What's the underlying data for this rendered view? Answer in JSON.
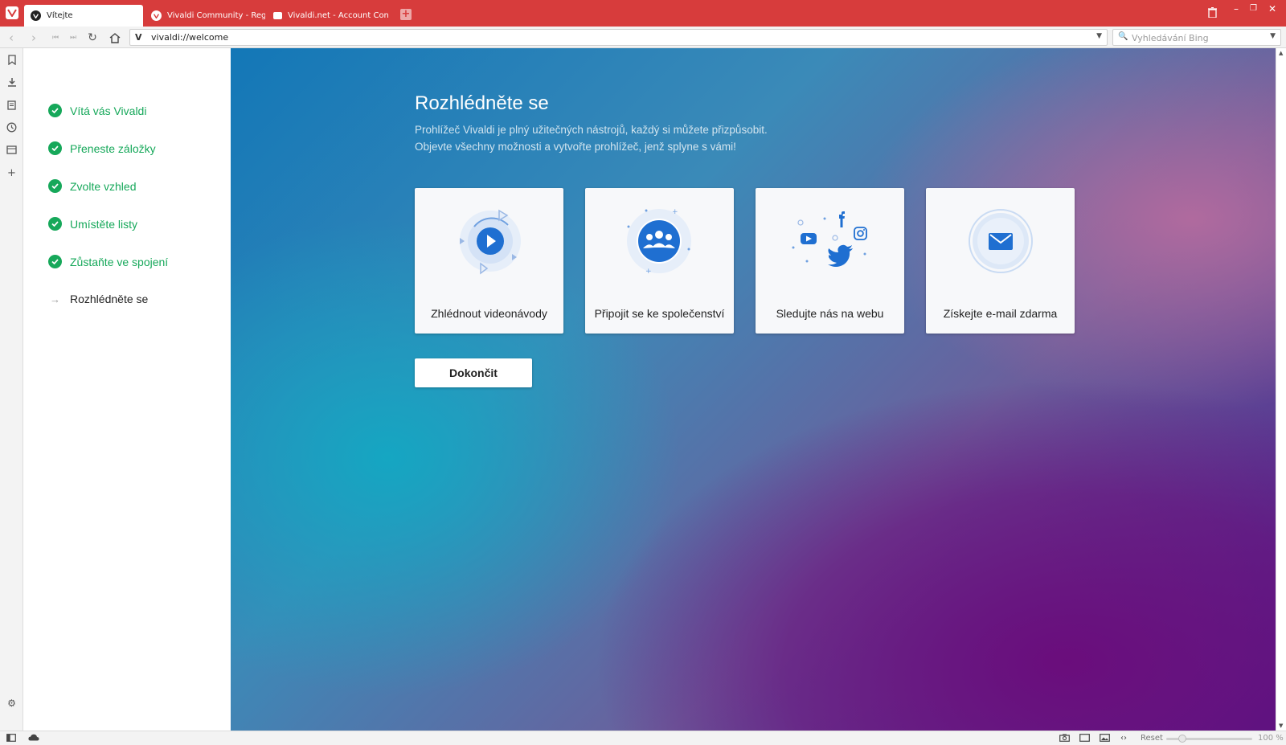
{
  "tabs": [
    {
      "label": "Vítejte",
      "active": true
    },
    {
      "label": "Vivaldi Community - Regist",
      "active": false
    },
    {
      "label": "Vivaldi.net - Account Confir",
      "active": false
    }
  ],
  "address": {
    "url": "vivaldi://welcome",
    "search_placeholder": "Vyhledávání Bing"
  },
  "steps": [
    {
      "label": "Vítá vás Vivaldi",
      "done": true
    },
    {
      "label": "Přeneste záložky",
      "done": true
    },
    {
      "label": "Zvolte vzhled",
      "done": true
    },
    {
      "label": "Umístěte listy",
      "done": true
    },
    {
      "label": "Zůstaňte ve spojení",
      "done": true
    },
    {
      "label": "Rozhlédněte se",
      "done": false
    }
  ],
  "main": {
    "title": "Rozhlédněte se",
    "subtitle_line1": "Prohlížeč Vivaldi je plný užitečných nástrojů, každý si můžete přizpůsobit.",
    "subtitle_line2": "Objevte všechny možnosti a vytvořte prohlížeč, jenž splyne s vámi!",
    "cards": [
      {
        "label": "Zhlédnout videonávody",
        "icon": "play-icon"
      },
      {
        "label": "Připojit se ke společenství",
        "icon": "community-icon"
      },
      {
        "label": "Sledujte nás na webu",
        "icon": "social-icon"
      },
      {
        "label": "Získejte e-mail zdarma",
        "icon": "mail-icon"
      }
    ],
    "finish_label": "Dokončit"
  },
  "statusbar": {
    "reset_label": "Reset",
    "zoom": "100 %"
  },
  "colors": {
    "brand_red": "#d73c3c",
    "step_green": "#16a85a",
    "icon_blue": "#1f6fd1"
  }
}
